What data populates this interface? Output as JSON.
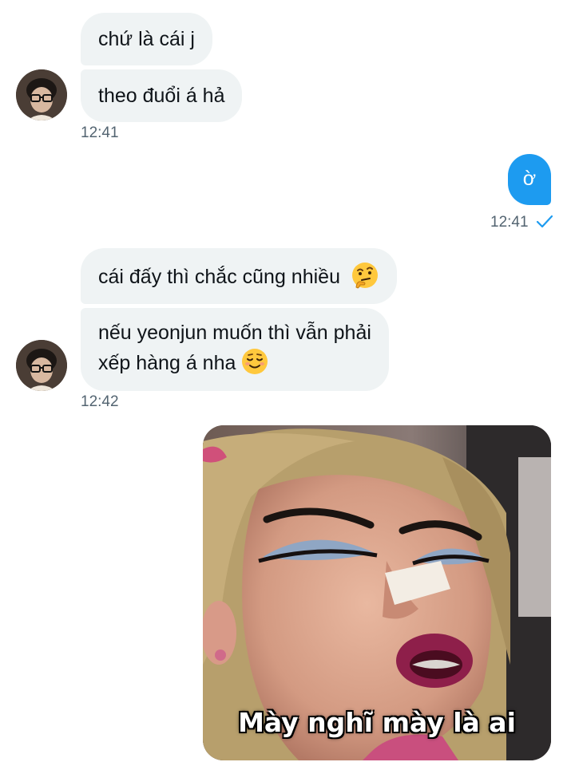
{
  "conversation": {
    "group1": {
      "messages": [
        "chứ là cái j",
        "theo đuổi á hả"
      ],
      "timestamp": "12:41"
    },
    "outgoing": {
      "message": "ờ",
      "timestamp": "12:41"
    },
    "group2": {
      "message1": "cái đấy thì chắc cũng nhiều",
      "message2_line1": "nếu yeonjun muốn thì vẫn phải",
      "message2_line2": "xếp hàng á nha",
      "timestamp": "12:42"
    },
    "meme": {
      "caption": "Mày nghĩ mày là ai"
    }
  },
  "icons": {
    "avatar": "avatar",
    "sent_check": "check-icon",
    "emoji1": "thinking-face",
    "emoji2": "smiling-face"
  },
  "colors": {
    "incoming_bubble": "#eff3f4",
    "outgoing_bubble": "#1d9bf0",
    "timestamp": "#536471"
  }
}
